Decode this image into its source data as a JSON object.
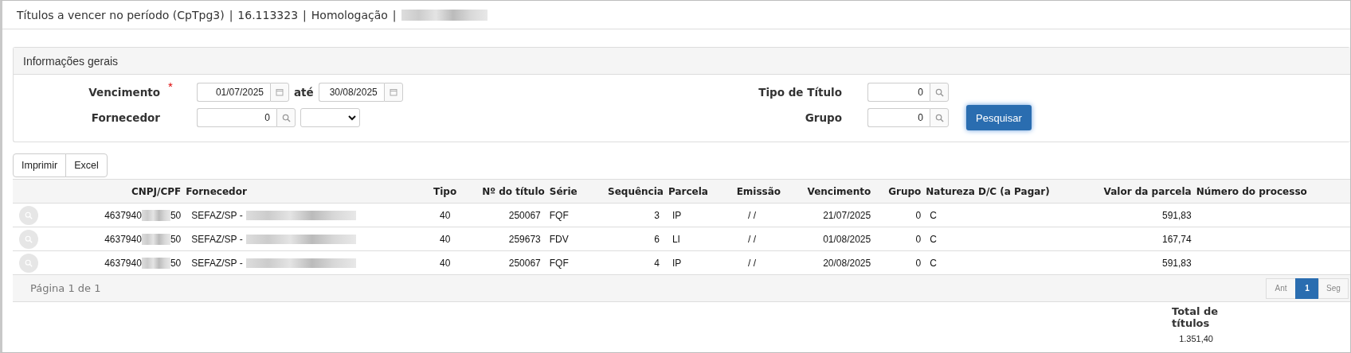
{
  "title": {
    "parts": [
      "Títulos a vencer no período (CpTpg3)",
      "|",
      "16.113323",
      "|",
      "Homologação",
      "|"
    ],
    "redacted": true
  },
  "panel": {
    "title": "Informações gerais",
    "vencimento": {
      "label": "Vencimento",
      "required": true,
      "required_mark": "*",
      "from": "01/07/2025",
      "joiner": "até",
      "to": "30/08/2025"
    },
    "fornecedor": {
      "label": "Fornecedor",
      "value": "0"
    },
    "tipo_titulo": {
      "label": "Tipo de Título",
      "value": "0"
    },
    "grupo": {
      "label": "Grupo",
      "value": "0"
    },
    "search_button": "Pesquisar"
  },
  "actions": [
    "Imprimir",
    "Excel"
  ],
  "table": {
    "columns": [
      "CNPJ/CPF",
      "Fornecedor",
      "Tipo",
      "Nº do título",
      "Série",
      "Sequência",
      "Parcela",
      "Emissão",
      "Vencimento",
      "Grupo",
      "Natureza D/C (a Pagar)",
      "Valor da parcela",
      "Número do processo"
    ],
    "rows": [
      {
        "cnpj_start": "4637940",
        "cnpj_end": "50",
        "fornecedor": "SEFAZ/SP -",
        "tipo": "40",
        "numero": "250067",
        "serie": "FQF",
        "sequencia": "3",
        "parcela": "IP",
        "emissao": "/ /",
        "vencimento": "21/07/2025",
        "grupo": "0",
        "natureza": "C",
        "valor": "591,83"
      },
      {
        "cnpj_start": "4637940",
        "cnpj_end": "50",
        "fornecedor": "SEFAZ/SP -",
        "tipo": "40",
        "numero": "259673",
        "serie": "FDV",
        "sequencia": "6",
        "parcela": "LI",
        "emissao": "/ /",
        "vencimento": "01/08/2025",
        "grupo": "0",
        "natureza": "C",
        "valor": "167,74"
      },
      {
        "cnpj_start": "4637940",
        "cnpj_end": "50",
        "fornecedor": "SEFAZ/SP -",
        "tipo": "40",
        "numero": "250067",
        "serie": "FQF",
        "sequencia": "4",
        "parcela": "IP",
        "emissao": "/ /",
        "vencimento": "20/08/2025",
        "grupo": "0",
        "natureza": "C",
        "valor": "591,83"
      }
    ]
  },
  "pagination": {
    "info": "Página 1 de 1",
    "pages": [
      {
        "label": "Ant",
        "selected": false
      },
      {
        "label": "1",
        "selected": true
      },
      {
        "label": "Seg",
        "selected": false
      }
    ]
  },
  "total": {
    "label": "Total de títulos",
    "value": "1.351,40"
  }
}
